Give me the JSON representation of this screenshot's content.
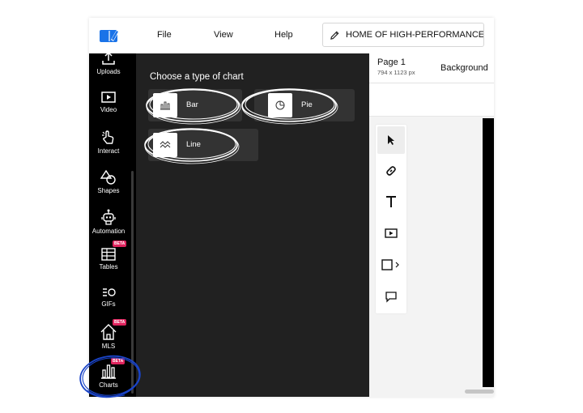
{
  "colors": {
    "accent": "#1a73e8",
    "beta": "#e0245e",
    "panel": "#212121",
    "sidebar": "#000000",
    "annotation": "#1a44c8"
  },
  "header": {
    "logo_icon": "brand-logo-icon",
    "menu": [
      "File",
      "View",
      "Help"
    ],
    "doc_title": "HOME OF HIGH-PERFORMANCE..."
  },
  "sidebar": {
    "items": [
      {
        "label": "Uploads",
        "icon": "upload-icon"
      },
      {
        "label": "Video",
        "icon": "video-icon"
      },
      {
        "label": "Interact",
        "icon": "interact-icon"
      },
      {
        "label": "Shapes",
        "icon": "shapes-icon"
      },
      {
        "label": "Automation",
        "icon": "robot-icon"
      },
      {
        "label": "Tables",
        "icon": "table-icon",
        "badge": "BETA"
      },
      {
        "label": "GIFs",
        "icon": "gif-icon"
      },
      {
        "label": "MLS",
        "icon": "house-icon",
        "badge": "BETA"
      },
      {
        "label": "Charts",
        "icon": "bar-chart-icon",
        "badge": "BETA",
        "active": true
      }
    ]
  },
  "chart_panel": {
    "title": "Choose a type of chart",
    "options": [
      {
        "label": "Bar",
        "icon": "bar-chart-icon"
      },
      {
        "label": "Pie",
        "icon": "pie-chart-icon"
      },
      {
        "label": "Line",
        "icon": "line-chart-icon"
      }
    ]
  },
  "canvas": {
    "page_name": "Page 1",
    "page_size": "794 x 1123 px",
    "background_tab": "Background",
    "tools": [
      "cursor-icon",
      "link-icon",
      "text-icon",
      "video-icon",
      "rectangle-icon",
      "comment-icon"
    ]
  }
}
